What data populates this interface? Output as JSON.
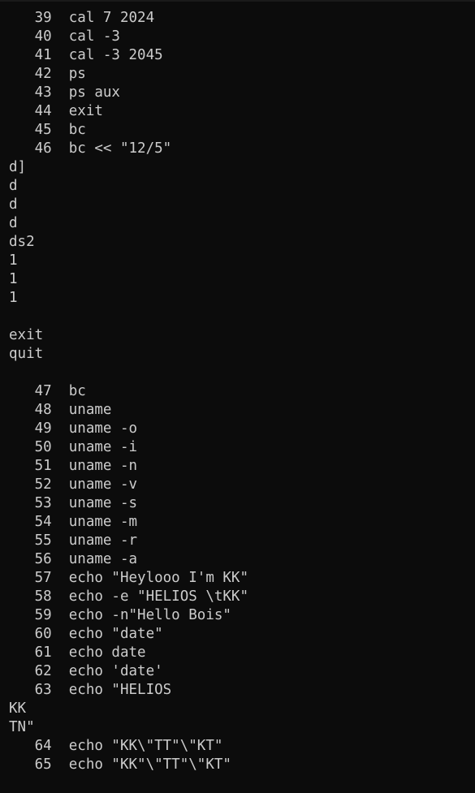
{
  "terminal": {
    "lines": [
      "   39  cal 7 2024",
      "   40  cal -3",
      "   41  cal -3 2045",
      "   42  ps",
      "   43  ps aux",
      "   44  exit",
      "   45  bc",
      "   46  bc << \"12/5\"",
      "d]",
      "d",
      "d",
      "d",
      "ds2",
      "1",
      "1",
      "1",
      "",
      "exit",
      "quit",
      "",
      "   47  bc",
      "   48  uname",
      "   49  uname -o",
      "   50  uname -i",
      "   51  uname -n",
      "   52  uname -v",
      "   53  uname -s",
      "   54  uname -m",
      "   55  uname -r",
      "   56  uname -a",
      "   57  echo \"Heylooo I'm KK\"",
      "   58  echo -e \"HELIOS \\tKK\"",
      "   59  echo -n\"Hello Bois\"",
      "   60  echo \"date\"",
      "   61  echo date",
      "   62  echo 'date'",
      "   63  echo \"HELIOS",
      "KK",
      "TN\"",
      "   64  echo \"KK\\\"TT\"\\\"KT\"",
      "   65  echo \"KK\"\\\"TT\"\\\"KT\""
    ]
  }
}
